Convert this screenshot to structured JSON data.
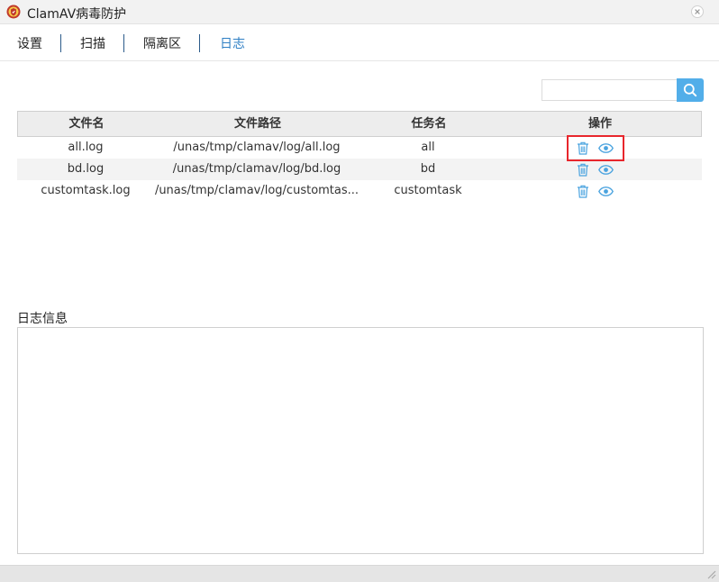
{
  "window": {
    "title": "ClamAV病毒防护"
  },
  "tabs": [
    {
      "label": "设置",
      "active": false
    },
    {
      "label": "扫描",
      "active": false
    },
    {
      "label": "隔离区",
      "active": false
    },
    {
      "label": "日志",
      "active": true
    }
  ],
  "search": {
    "value": "",
    "placeholder": "",
    "button_icon": "search-icon"
  },
  "table": {
    "columns": [
      "文件名",
      "文件路径",
      "任务名",
      "操作"
    ],
    "rows": [
      {
        "file_name": "all.log",
        "file_path": "/unas/tmp/clamav/log/all.log",
        "task_name": "all",
        "actions": [
          "trash-icon",
          "eye-icon"
        ]
      },
      {
        "file_name": "bd.log",
        "file_path": "/unas/tmp/clamav/log/bd.log",
        "task_name": "bd",
        "actions": [
          "trash-icon",
          "eye-icon"
        ]
      },
      {
        "file_name": "customtask.log",
        "file_path": "/unas/tmp/clamav/log/customtas...",
        "task_name": "customtask",
        "actions": [
          "trash-icon",
          "eye-icon"
        ]
      }
    ]
  },
  "log_info": {
    "label": "日志信息",
    "content": ""
  },
  "colors": {
    "accent": "#52aee9",
    "active_tab": "#2e7fc4",
    "icon_blue": "#4aa3df",
    "highlight": "#e8262c"
  }
}
